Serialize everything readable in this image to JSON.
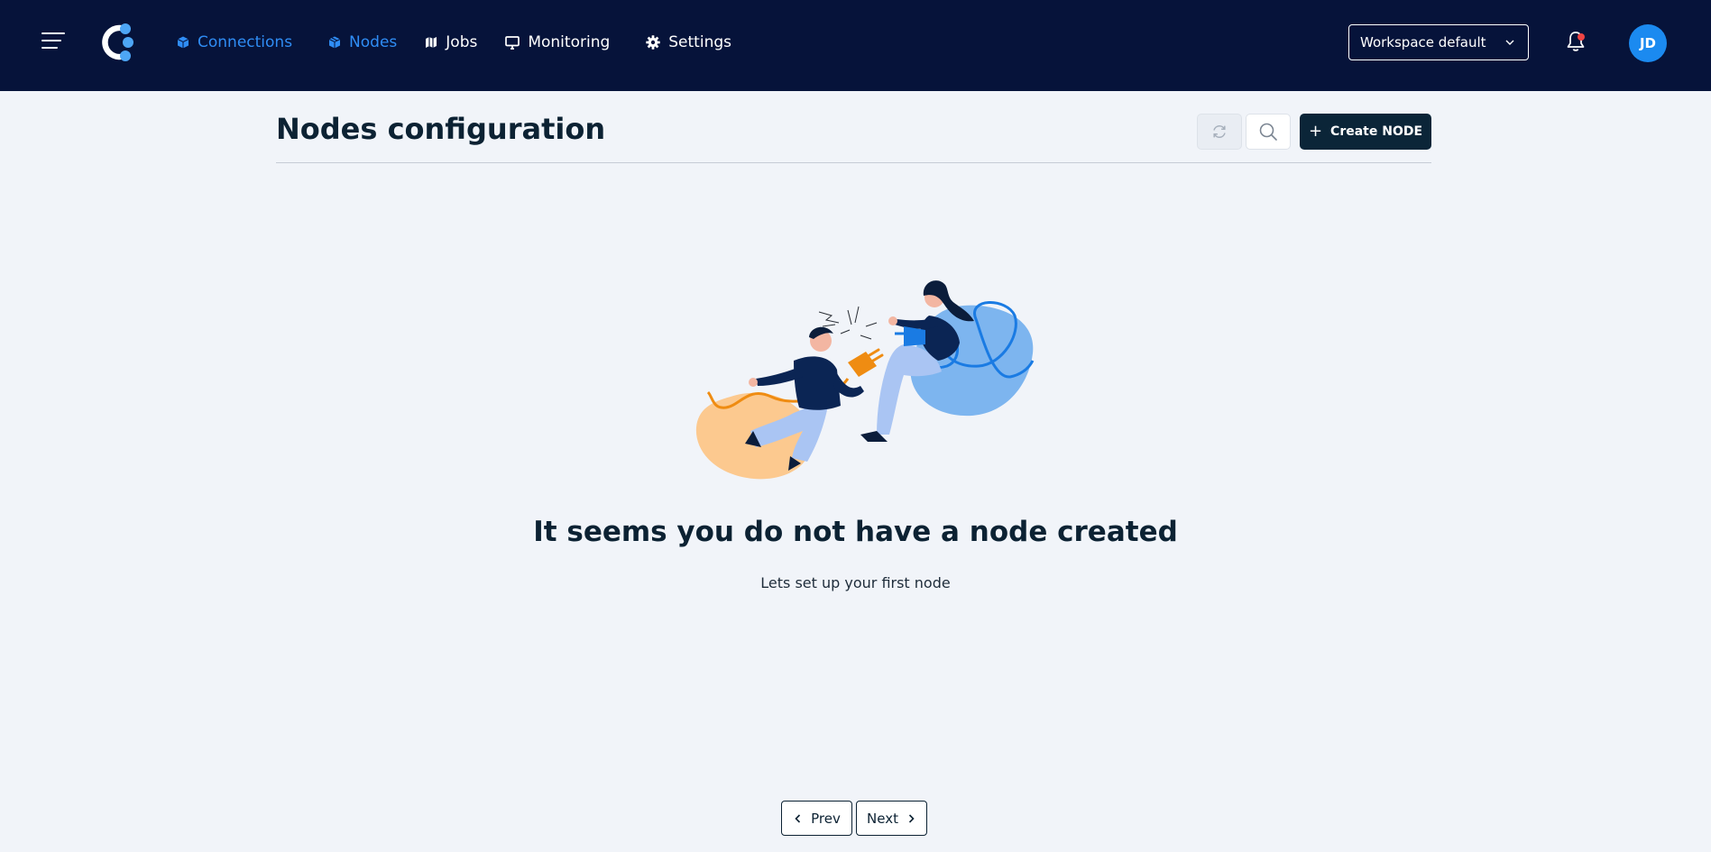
{
  "header": {
    "nav": [
      {
        "label": "Connections",
        "icon": "cube-icon",
        "active": true
      },
      {
        "label": "Nodes",
        "icon": "cubes-icon",
        "active": true
      },
      {
        "label": "Jobs",
        "icon": "map-icon",
        "active": false
      },
      {
        "label": "Monitoring",
        "icon": "monitor-icon",
        "active": false
      },
      {
        "label": "Settings",
        "icon": "gear-icon",
        "active": false
      }
    ],
    "workspace_select": {
      "value": "Workspace default"
    },
    "user_initials": "JD",
    "has_notification": true
  },
  "page": {
    "title": "Nodes configuration",
    "create_button": "Create NODE"
  },
  "empty_state": {
    "title": "It seems you do not have a node created",
    "subtitle": "Lets set up your first node"
  },
  "pagination": {
    "prev": "Prev",
    "next": "Next"
  },
  "colors": {
    "topbar": "#06133a",
    "accent": "#2f8df5",
    "primary_button": "#0b2538",
    "background": "#f1f4f9",
    "notification": "#ef4444"
  }
}
